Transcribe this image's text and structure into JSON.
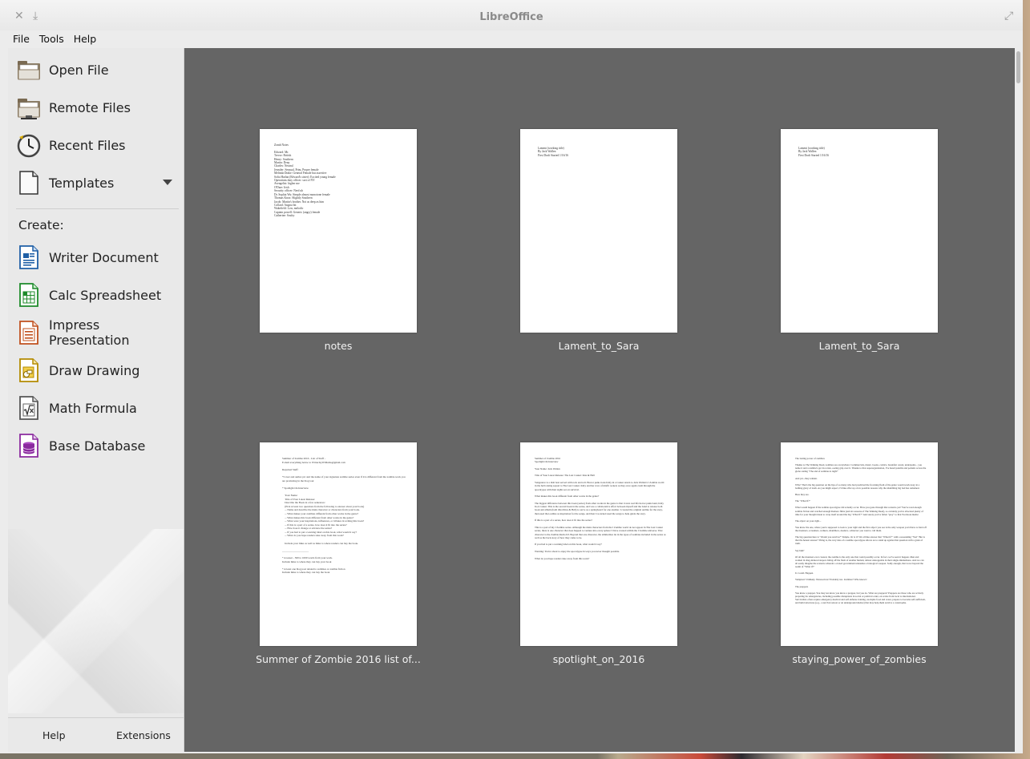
{
  "window": {
    "title": "LibreOffice"
  },
  "menu": [
    "File",
    "Tools",
    "Help"
  ],
  "sidebar": {
    "open_file": "Open File",
    "remote_files": "Remote Files",
    "recent_files": "Recent Files",
    "templates": "Templates",
    "create_label": "Create:",
    "create_items": [
      "Writer Document",
      "Calc Spreadsheet",
      "Impress Presentation",
      "Draw Drawing",
      "Math Formula",
      "Base Database"
    ],
    "help": "Help",
    "extensions": "Extensions"
  },
  "recent": [
    {
      "name": "notes",
      "preview": "Zomb Notes\n\nEdward: Mr.\nTrevor: British\nHenry: Southern\nMartin: Deep\nCharles: Neutral\nJennifer: Sensual, Prim, Proper female\nMelinda Drake: General Female but assertive\nSofia Harlan (Edward's sister): Excited young female\nOperations duty officer: sort of NY\nAvengelist: higher me\nO'Dare: Irish\nSecurity officer: Nerd uh\nDr. Sophia Wu: Simple almost monotone female\nThomas Knox: Slightly Southern\nJacob: Martin's brother. Not as deep as him\nCollard: Angust bit\nWakefield: Low, melodic\nCaptain powell: Generic (angry) female\nCatherine: Soulry"
    },
    {
      "name": "Lament_to_Sara",
      "preview": "Lament (working title)\nBy Jack Wallen\nFirst Draft Started 1/16/16"
    },
    {
      "name": "Lament_to_Sara",
      "preview": "Lament (working title)\nBy Jack Wallen\nFirst Draft Started 1/16/16"
    },
    {
      "name": "Summer of Zombie 2016 list of...",
      "preview": "Summer of Zombie 2016 - List of Stuff -\nE-mail everything below to WriterJayWilliams@gmail.com\n\nRequired Stuff:\n\n*Cover and author pic and the name of your signature zombie series even if it is different from the zombie work you are promoting in the blog tour\n\n* Spotlight On Interview\n\n    Your Name:\n    Title of Your Latest Release:\n    Describe the Book in a few sentences:\n    (Pick at least two questions from the following to answer about your book)\n    -- Name and describe the main character or characters from your book.\n    -- What makes your zombies different from other works in the genre?\n    -- What makes this book different from other works in the genre?\n    -- What were your inspirations, influences, or tributes in writing this book?\n    -- If this is a part of a series, how does it fit into the series?\n    -- How does it change or advance the series?\n    -- If you had to put a warning label on this book, what would it say?\n    -- What do you hope readers take away from this work?\n\n    Include your links as well as links to where readers can buy the book.\n\n____________________\n\n* A teaser - 500 to 1000 words from your work.\nInclude links to where they can buy your book\n\n* A least one blog post related to zombies or zombie fiction\nInclude links to where they can buy the book"
    },
    {
      "name": "spotlight_on_2016",
      "preview": "Summer of Zombie 2016\nSpotlight On Interview\n\nYour Name: Jack Wallen\n\nTitle of Your Latest Release: The Last Casket: Kiss & Hell\n\nVengeance is a dish best served with rock and roll. Horror punk icons Kitty in a Casket return to Jack Wallen's I Zombie world in the hell raising sequel to The Last Casket. Kitty and her crew of misfit rockers as they once again crash through the apocalypse with their sights set on survival.\n\nWhat makes this book different from other works in the genre?\n\nThe biggest difference between this book (series) from other works in the genre is that it stars real life horror punk band, Kitty In A Casket. This is the second book in the series, and was a collaborative effort between myself and the band to release both book and album (both titled Kiss & Hell) to serve as a springboard for one another. I created the original outline for the story, then used that outline as inspiration for the songs, and then I re-turned used the songs to help guide the story.\n\nIf this is a part of a series, how does it fit into the series?\n\nThis is a part of my I Zombie series. Although the main characters from the I Zombie world do not appear in The Last Casket series, there is one character that does happen to venture into every sphere! I have created within the I Zombie universe. That character is the Zombie Radio DJ. Beyond that one character, the similarities lie in the types of zombies included in the series as well as the back story of how they came to be.\n\nIf you had to put a warning label on this book, what would it say?\n\nWarning: You're about to enjoy the apocalypse in ways you never thought possible.\n\nWhat do you hope readers take away from this work?"
    },
    {
      "name": "staying_power_of_zombies",
      "preview": "The lasting power of zombies\n\nThanks to The Walking Dead, zombies are everywhere: Commercials, music, books, comics, breakfast cereal, underpants... you name it and a zombie's got its rotten, oozing grip over it. Thanks to that superorganization, I've heard pundits and pedants across the globe stating \"The end of zombies is nigh!\"\n\nAnd yet...they remain.\n\nWhy? That's the big question on the lips of so many who had predicted the frowning flesh of the genre would wash away in a bathing glory of trash. As you might expect, I'd like offer up a few possible reasons why the shambling big bad has remained.\n\nHere they are.\n\nThe \"What If?\"\n\nWhat would happen if the zombie apocalypse did actually occur. Have you gone through that scenario yet? You've read enough zombie fiction and watched enough Romero films (and six seasons of The Walking Dead), so certainly you've allocated plenty of time for your thought mean to wrap itself around the big \"What If?\" And surely you've fallen \"prey\" to that Facebook meme:\n\nThe object on your right...\n\nYou know the one, where you're supposed to look to your right and the first object you see is the only weapon you'd have to fend off the monsters, screamers, walkers, shamblers, deaders...whatever you want to call them.\n\nThe big question here is \"Would you survive?\" Simple. Or is it? We all like answer that \"What if?\" with a resounding \"Yes!\" But is that the honest answer? Thing is, the very idea of a zombie apocalypse allows us to stand up against that question with a grain of truth.\n\nSay huh?\n\nOf all the monsters ever created, the zombie is the only one that could possibly occur. In fact, we've seen it happen. Men and women in drug-induced stupors biting off the flesh of another human; almost unstoppable in their single-mindedness. And we can all easily imagine the scenario wherein a crazed government unleashes a biological weapon. Sadly enough, that is not beyond the realm of \"What if?\"\n\nIt. Could. Happen.\n\nVampires? Unlikely. Werewolves? Probably not. Zombies? Who knows!\n\nThe preppers\n\nYou know a prepper. You may not know you know a prepper, but you do. What are preppers? Preppers are those who are actively preparing for emergencies, including possible disruptions in social or political order, on scales from local to international. Survivalists often acquire emergency medical and self-defense training, stockpile food and water, prepare to become self-sufficient, and build structures (e.g., a survival retreat or an underground shelter) that may help them survive a catastrophe."
    }
  ]
}
